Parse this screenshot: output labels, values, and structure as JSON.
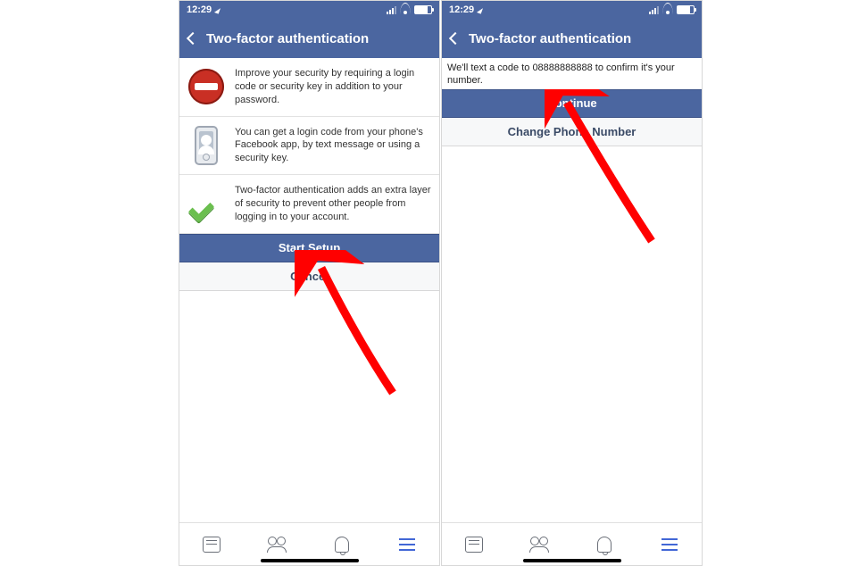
{
  "statusbar": {
    "time": "12:29"
  },
  "header": {
    "title": "Two-factor authentication"
  },
  "screen1": {
    "row1": "Improve your security by requiring a login code or security key in addition to your password.",
    "row2": "You can get a login code from your phone's Facebook app, by text message or using a security key.",
    "row3": "Two-factor authentication adds an extra layer of security to prevent other people from logging in to your account.",
    "primary": "Start Setup",
    "secondary": "Cancel"
  },
  "screen2": {
    "message": "We'll text a code to 08888888888 to confirm it's your number.",
    "primary": "Continue",
    "secondary": "Change Phone Number"
  }
}
